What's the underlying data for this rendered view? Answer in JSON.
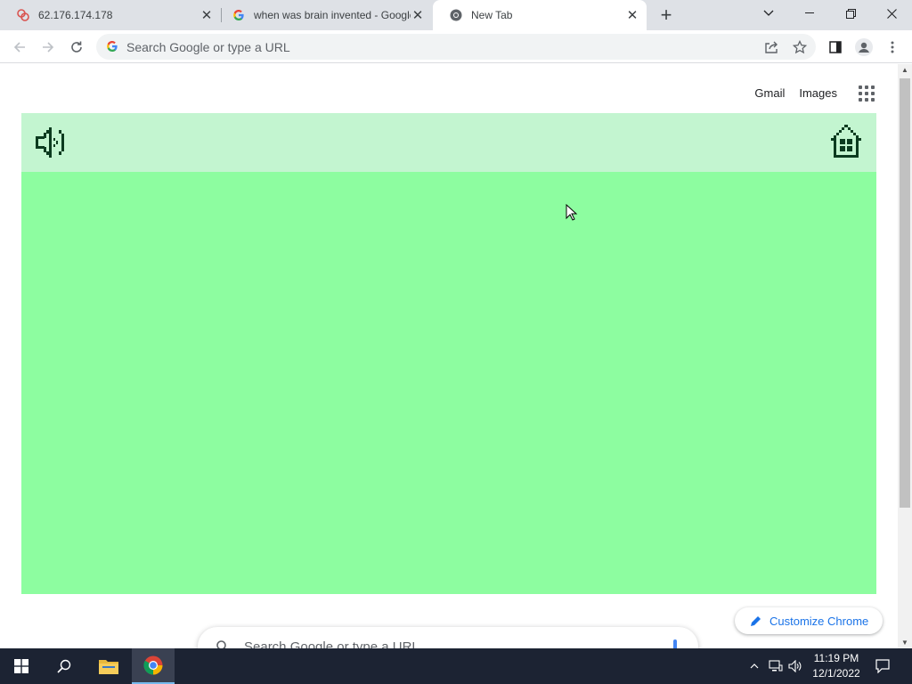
{
  "browser": {
    "tabs": [
      {
        "title": "62.176.174.178",
        "favicon": "remote-desktop-icon",
        "active": false
      },
      {
        "title": "when was brain invented - Google Search",
        "favicon": "google-g-icon",
        "active": false
      },
      {
        "title": "New Tab",
        "favicon": "chrome-icon",
        "active": true
      }
    ],
    "new_tab_icon": "plus-icon",
    "window_controls": [
      "chevron-down-icon",
      "minimize-icon",
      "restore-icon",
      "close-icon"
    ]
  },
  "toolbar": {
    "omnibox_placeholder": "Search Google or type a URL",
    "icons": [
      "back-arrow-icon",
      "forward-arrow-icon",
      "reload-icon",
      "share-icon",
      "star-icon",
      "side-panel-icon",
      "profile-icon",
      "more-menu-icon"
    ]
  },
  "newtab": {
    "links": {
      "gmail": "Gmail",
      "images": "Images"
    },
    "search_placeholder": "Search Google or type a URL",
    "customize_label": "Customize Chrome"
  },
  "game": {
    "background": "#8dfda0",
    "header_background": "#c3f5d0",
    "icon_color": "#0b3b1f",
    "icons": [
      "sound-toggle-icon",
      "home-icon"
    ]
  },
  "taskbar": {
    "time": "11:19 PM",
    "date": "12/1/2022",
    "icons": [
      "windows-start-icon",
      "search-icon",
      "file-explorer-icon",
      "chrome-icon",
      "chevron-up-icon",
      "network-icon",
      "volume-icon",
      "notification-icon"
    ]
  }
}
